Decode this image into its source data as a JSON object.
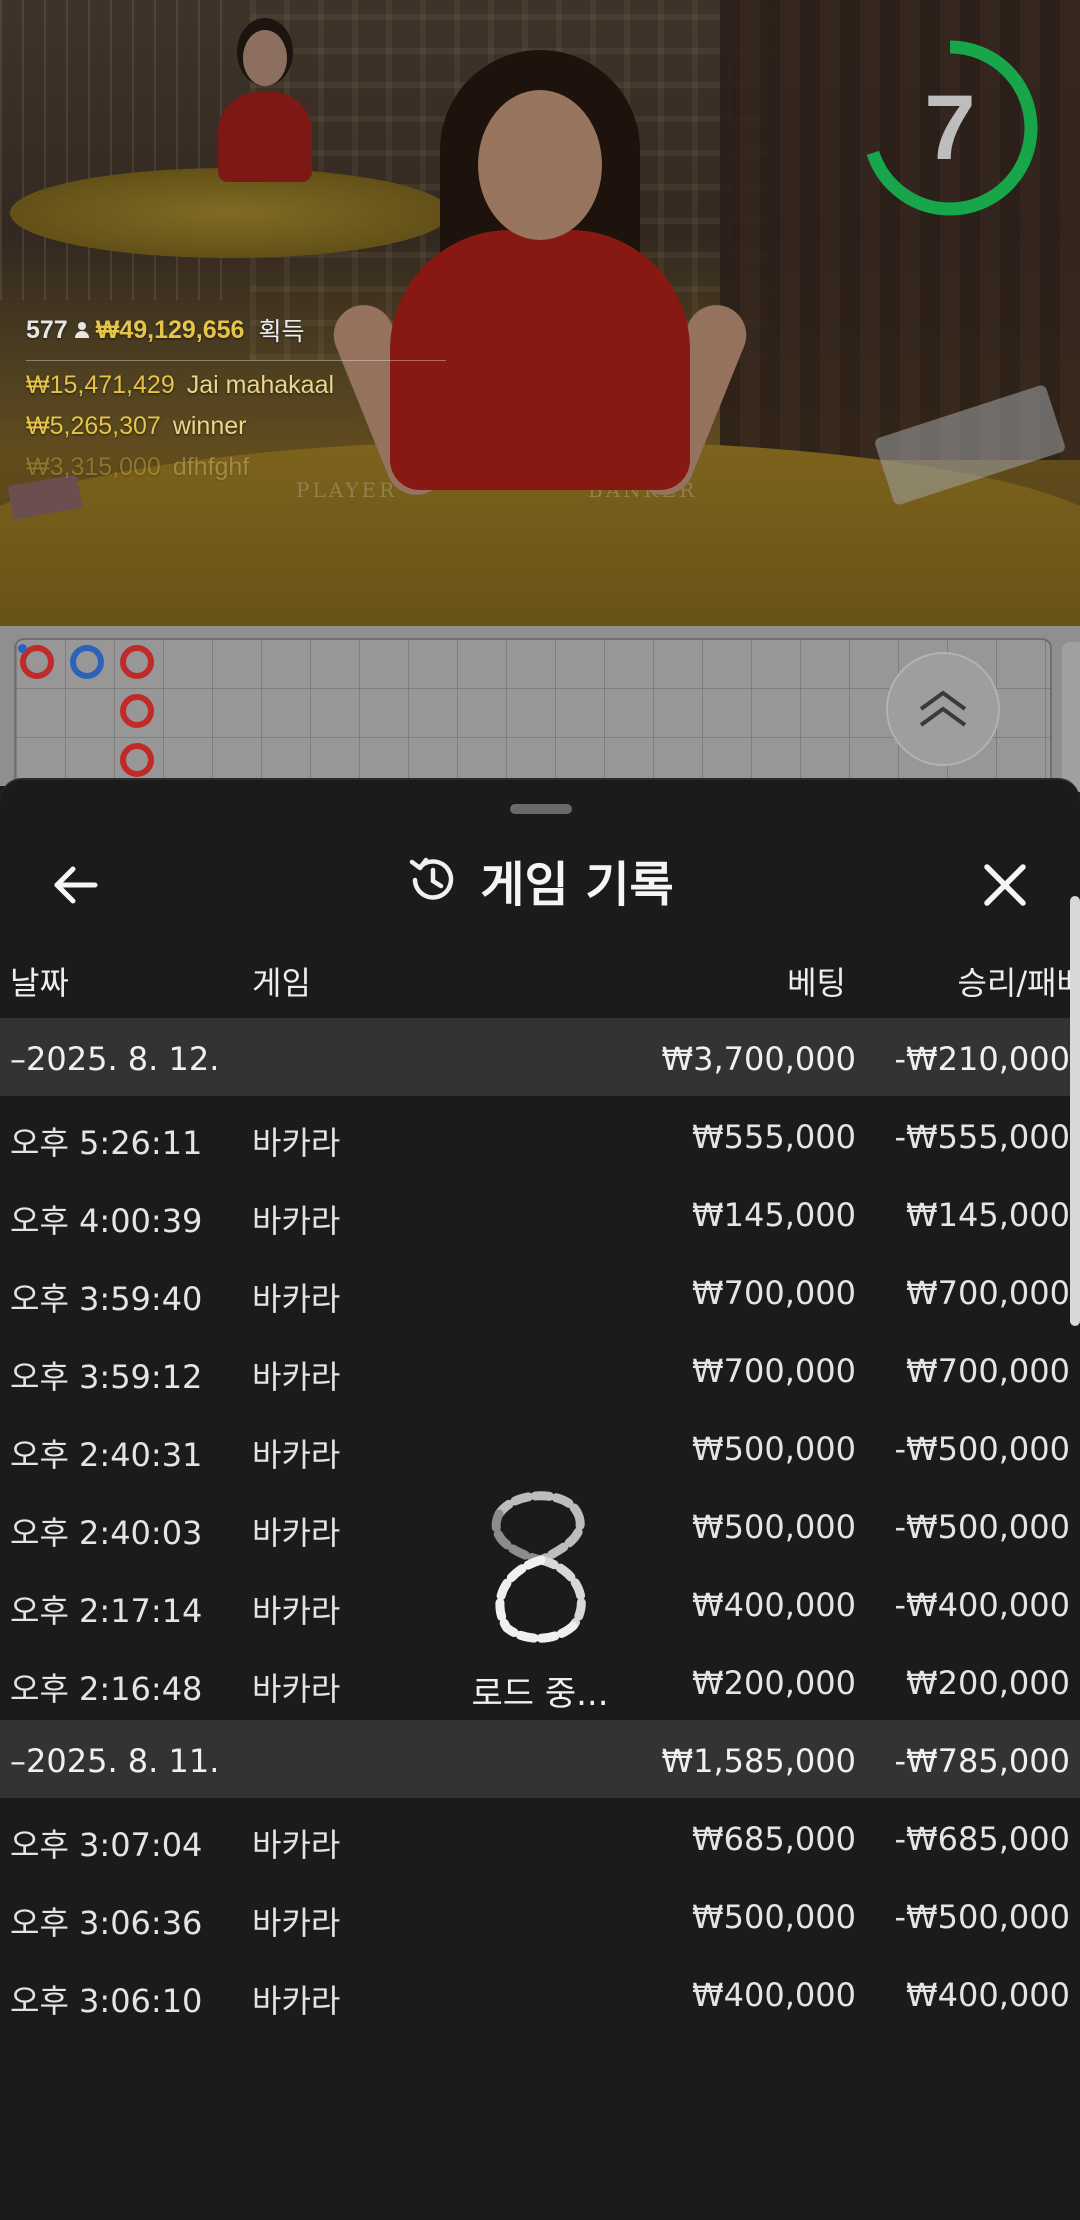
{
  "live": {
    "timer": "7",
    "timer_fraction": 0.7,
    "timer_color": "#17a74a",
    "winners": {
      "players": "577",
      "total_amount": "₩49,129,656",
      "total_suffix": "획득",
      "list": [
        {
          "amount": "₩15,471,429",
          "name": "Jai mahakaal"
        },
        {
          "amount": "₩5,265,307",
          "name": "winner"
        },
        {
          "amount": "₩3,315,000",
          "name": "dfhfghf"
        }
      ]
    },
    "table_labels": {
      "player": "PLAYER",
      "banker": "BANKER"
    }
  },
  "roadmap": {
    "colors": {
      "banker": "#c12a2a",
      "player": "#2c63b8"
    },
    "expand_icon": "double-chevron-up-icon"
  },
  "sheet": {
    "title": "게임 기록",
    "title_icon": "history-icon",
    "back_icon": "arrow-left-icon",
    "close_icon": "close-icon",
    "columns": {
      "date": "날짜",
      "game": "게임",
      "bet": "베팅",
      "result": "승리/패배"
    },
    "groups": [
      {
        "date": "–2025. 8. 12.",
        "bet_total": "₩3,700,000",
        "result_total": "-₩210,000",
        "rows": [
          {
            "time": "오후 5:26:11",
            "game": "바카라",
            "bet": "₩555,000",
            "result": "-₩555,000"
          },
          {
            "time": "오후 4:00:39",
            "game": "바카라",
            "bet": "₩145,000",
            "result": "₩145,000"
          },
          {
            "time": "오후 3:59:40",
            "game": "바카라",
            "bet": "₩700,000",
            "result": "₩700,000"
          },
          {
            "time": "오후 3:59:12",
            "game": "바카라",
            "bet": "₩700,000",
            "result": "₩700,000"
          },
          {
            "time": "오후 2:40:31",
            "game": "바카라",
            "bet": "₩500,000",
            "result": "-₩500,000"
          },
          {
            "time": "오후 2:40:03",
            "game": "바카라",
            "bet": "₩500,000",
            "result": "-₩500,000"
          },
          {
            "time": "오후 2:17:14",
            "game": "바카라",
            "bet": "₩400,000",
            "result": "-₩400,000"
          },
          {
            "time": "오후 2:16:48",
            "game": "바카라",
            "bet": "₩200,000",
            "result": "₩200,000"
          }
        ]
      },
      {
        "date": "–2025. 8. 11.",
        "bet_total": "₩1,585,000",
        "result_total": "-₩785,000",
        "rows": [
          {
            "time": "오후 3:07:04",
            "game": "바카라",
            "bet": "₩685,000",
            "result": "-₩685,000"
          },
          {
            "time": "오후 3:06:36",
            "game": "바카라",
            "bet": "₩500,000",
            "result": "-₩500,000"
          },
          {
            "time": "오후 3:06:10",
            "game": "바카라",
            "bet": "₩400,000",
            "result": "₩400,000"
          }
        ]
      }
    ],
    "loading_label": "로드 중..."
  }
}
